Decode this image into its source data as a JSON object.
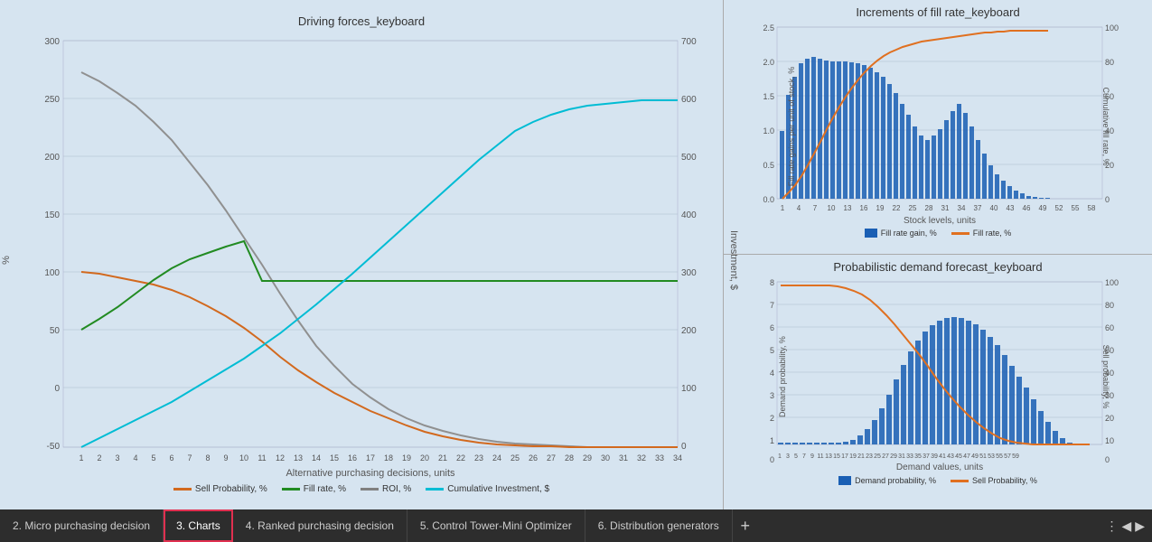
{
  "title_left": "Driving forces_keyboard",
  "title_right_top": "Increments of fill rate_keyboard",
  "title_right_bottom": "Probabilistic demand forecast_keyboard",
  "left_chart": {
    "x_label": "Alternative purchasing decisions, units",
    "y_label_left": "%",
    "y_label_right": "Investment, $",
    "y_left_ticks": [
      "300",
      "250",
      "200",
      "150",
      "100",
      "50",
      "0",
      "-50"
    ],
    "y_right_ticks": [
      "700",
      "600",
      "500",
      "400",
      "300",
      "200",
      "100",
      "0"
    ],
    "x_ticks": [
      "1",
      "2",
      "3",
      "4",
      "5",
      "6",
      "7",
      "8",
      "9",
      "10",
      "11",
      "12",
      "13",
      "14",
      "15",
      "16",
      "17",
      "18",
      "19",
      "20",
      "21",
      "22",
      "23",
      "24",
      "25",
      "26",
      "27",
      "28",
      "29",
      "30",
      "31",
      "32",
      "33",
      "34"
    ],
    "legend": [
      {
        "label": "Sell Probability, %",
        "color": "#d2691e",
        "type": "line"
      },
      {
        "label": "Fill rate, %",
        "color": "#228b22",
        "type": "line"
      },
      {
        "label": "ROI, %",
        "color": "#808080",
        "type": "line"
      },
      {
        "label": "Cumulative Investment, $",
        "color": "#00bcd4",
        "type": "line"
      }
    ]
  },
  "right_top_chart": {
    "x_label": "Stock levels, units",
    "y_label_left": "Fill rate gains per unit of stock, %",
    "y_label_right": "Cumulative fill rate, %",
    "legend": [
      {
        "label": "Fill rate gain, %",
        "color": "#1a5fb4",
        "type": "bar"
      },
      {
        "label": "Fill rate, %",
        "color": "#e07020",
        "type": "line"
      }
    ]
  },
  "right_bottom_chart": {
    "x_label": "Demand values, units",
    "y_label_left": "Demand probability, %",
    "y_label_right": "Sell probability, %",
    "legend": [
      {
        "label": "Demand probability, %",
        "color": "#1a5fb4",
        "type": "bar"
      },
      {
        "label": "Sell Probability, %",
        "color": "#e07020",
        "type": "line"
      }
    ]
  },
  "tabs": [
    {
      "label": "2. Micro purchasing decision",
      "active": false
    },
    {
      "label": "3. Charts",
      "active": true
    },
    {
      "label": "4. Ranked purchasing decision",
      "active": false
    },
    {
      "label": "5. Control Tower-Mini Optimizer",
      "active": false
    },
    {
      "label": "6. Distribution generators",
      "active": false
    }
  ],
  "tab_add_icon": "+",
  "nav_icons": [
    "⋮",
    "◀",
    "▶"
  ]
}
